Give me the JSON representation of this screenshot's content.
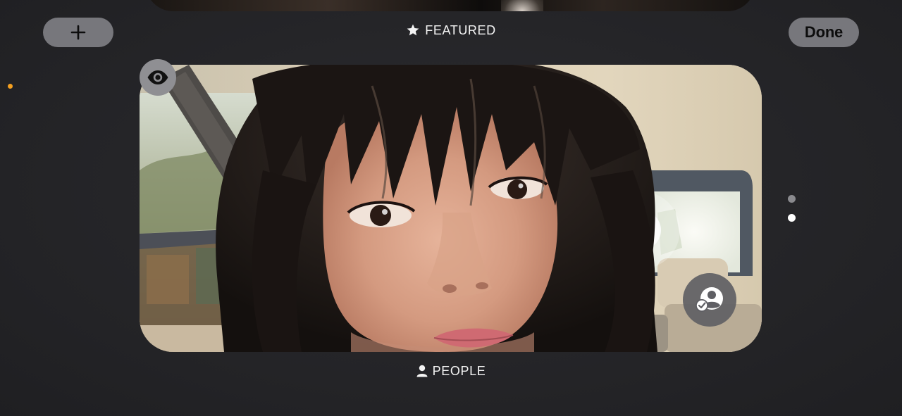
{
  "toolbar": {
    "add_label": "+",
    "done_label": "Done"
  },
  "sections": {
    "featured": {
      "label": "FEATURED",
      "icon": "star-icon"
    },
    "people": {
      "label": "PEOPLE",
      "icon": "person-icon"
    }
  },
  "card": {
    "icons": {
      "visibility": "eye-icon",
      "people_filter": "people-check-icon"
    }
  },
  "pagination": {
    "count": 2,
    "active_index": 1
  },
  "colors": {
    "background": "#252528",
    "button": "#77777c",
    "status_dot": "#f5a020",
    "active_dot": "#ffffff",
    "inactive_dot": "#8a8a8e"
  }
}
